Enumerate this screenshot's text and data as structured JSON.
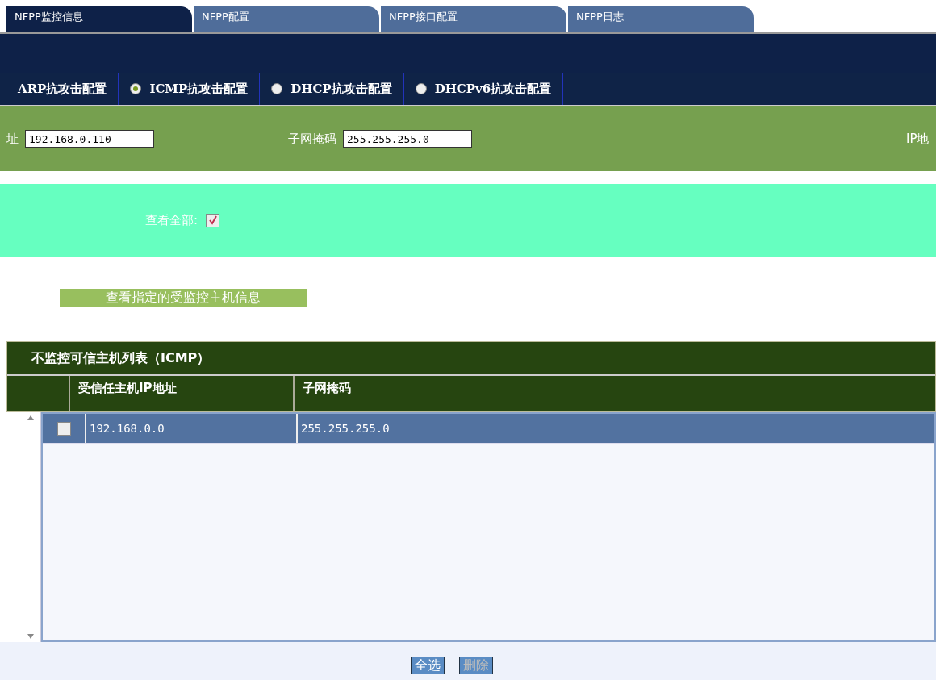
{
  "tabs": [
    {
      "label": "NFPP监控信息",
      "selected": true
    },
    {
      "label": "NFPP配置",
      "selected": false
    },
    {
      "label": "NFPP接口配置",
      "selected": false
    },
    {
      "label": "NFPP日志",
      "selected": false
    }
  ],
  "attack_tabs": [
    {
      "label": "ARP抗攻击配置",
      "selected": false,
      "kind": "plain"
    },
    {
      "label": "ICMP抗攻击配置",
      "selected": true,
      "kind": "radio"
    },
    {
      "label": "DHCP抗攻击配置",
      "selected": false,
      "kind": "radio"
    },
    {
      "label": "DHCPv6抗攻击配置",
      "selected": false,
      "kind": "radio"
    }
  ],
  "form": {
    "ip_label": "址",
    "ip_value": "192.168.0.110",
    "mask_label": "子网掩码",
    "mask_value": "255.255.255.0",
    "right_label": "IP地"
  },
  "view_all": {
    "label": "查看全部:",
    "checked": true
  },
  "view_button": "查看指定的受监控主机信息",
  "table": {
    "title": "不监控可信主机列表（ICMP）",
    "columns": [
      "受信任主机IP地址",
      "子网掩码"
    ],
    "rows": [
      {
        "checked": false,
        "selected": true,
        "cells": [
          "192.168.0.0",
          "255.255.255.0"
        ]
      }
    ]
  },
  "buttons": [
    {
      "label": "全选",
      "disabled": false
    },
    {
      "label": "删除",
      "disabled": true
    }
  ]
}
